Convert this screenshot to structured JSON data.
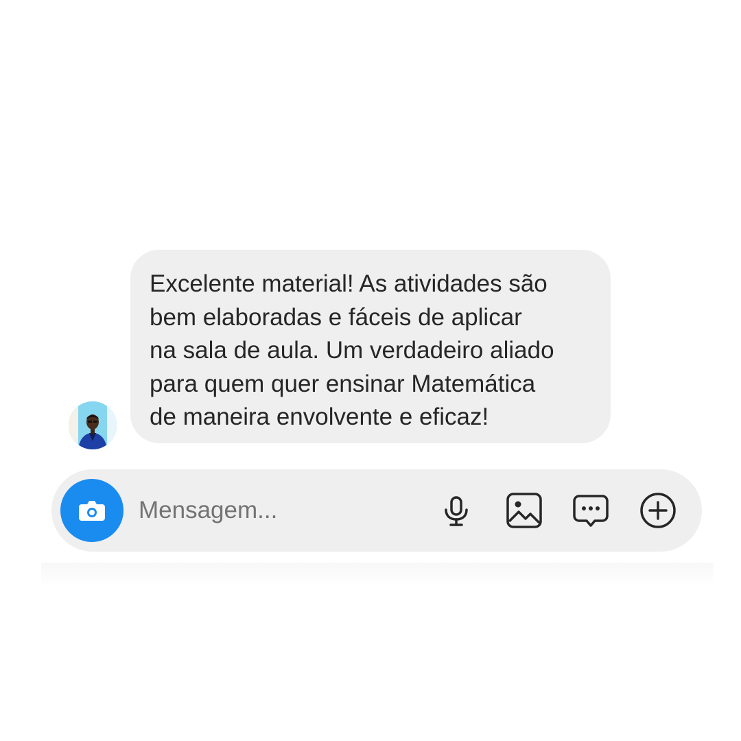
{
  "message": {
    "lines": [
      "Excelente material! As atividades são",
      "bem elaboradas e fáceis de aplicar",
      "na sala de aula. Um verdadeiro aliado",
      "para quem quer ensinar Matemática",
      "de maneira envolvente e eficaz!"
    ]
  },
  "composer": {
    "placeholder": "Mensagem...",
    "value": "",
    "icons": {
      "camera": "camera-icon",
      "microphone": "microphone-icon",
      "gallery": "gallery-icon",
      "sticker": "sticker-icon",
      "more": "plus-circle-icon"
    }
  },
  "colors": {
    "accent": "#1a8cf0",
    "bubble": "#efefef",
    "text": "#262626",
    "placeholder": "#737373"
  }
}
